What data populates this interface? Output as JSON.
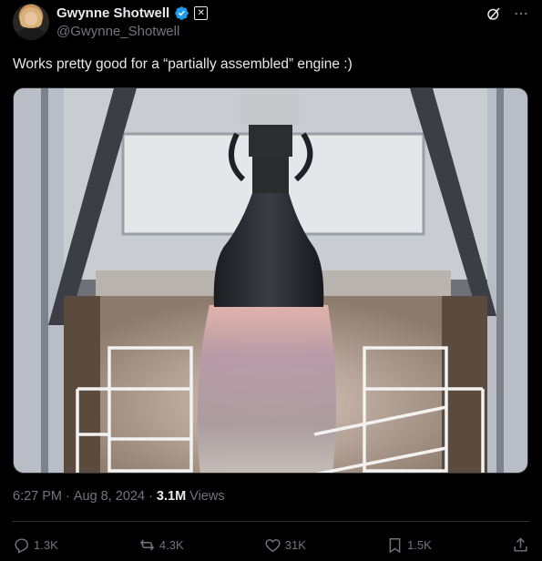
{
  "author": {
    "display_name": "Gwynne Shotwell",
    "handle": "@Gwynne_Shotwell"
  },
  "icons": {
    "verified": "verified-badge-icon",
    "affiliate": "x-affiliate-icon",
    "grok": "grok-icon",
    "more": "more-icon",
    "reply": "reply-icon",
    "repost": "repost-icon",
    "like": "like-icon",
    "bookmark": "bookmark-icon",
    "share": "share-icon"
  },
  "colors": {
    "verified": "#1d9bf0",
    "muted": "#71767b",
    "text": "#e7e9ea",
    "background": "#000000"
  },
  "tweet": {
    "text": "Works pretty good for a “partially assembled” engine :)"
  },
  "meta": {
    "time": "6:27 PM",
    "separator": "·",
    "date": "Aug 8, 2024",
    "views_count": "3.1M",
    "views_label": "Views"
  },
  "actions": {
    "replies": "1.3K",
    "reposts": "4.3K",
    "likes": "31K",
    "bookmarks": "1.5K"
  }
}
